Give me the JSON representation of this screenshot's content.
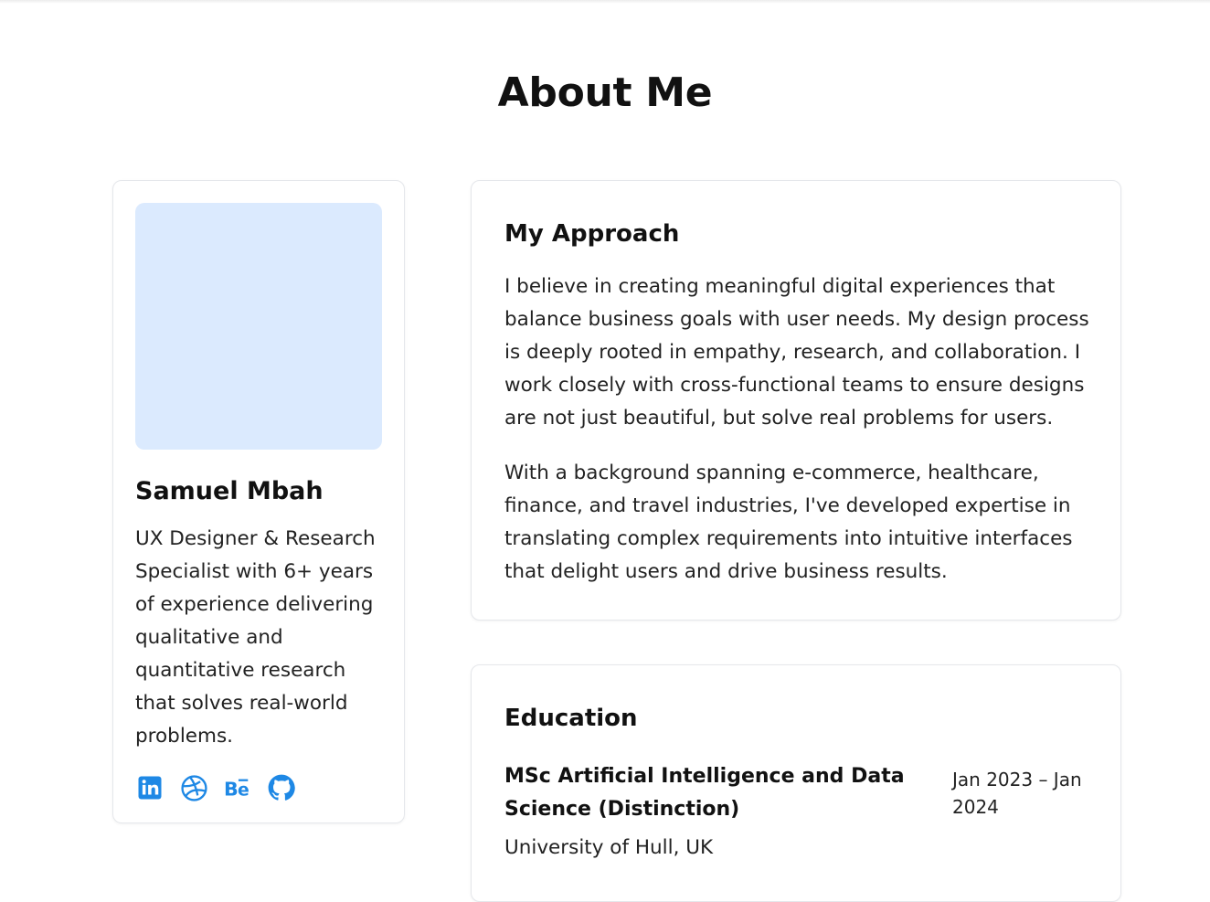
{
  "page": {
    "title": "About Me"
  },
  "profile": {
    "name": "Samuel Mbah",
    "bio": "UX Designer & Research Specialist with 6+ years of experience delivering qualitative and quantitative research that solves real-world problems.",
    "social_icons": [
      "linkedin-icon",
      "dribbble-icon",
      "behance-icon",
      "github-icon"
    ],
    "avatar_color": "#dbeafe",
    "accent_color": "#1e88e5"
  },
  "approach": {
    "title": "My Approach",
    "paragraphs": [
      "I believe in creating meaningful digital experiences that balance business goals with user needs. My design process is deeply rooted in empathy, research, and collaboration. I work closely with cross-functional teams to ensure designs are not just beautiful, but solve real problems for users.",
      "With a background spanning e-commerce, healthcare, finance, and travel industries, I've developed expertise in translating complex requirements into intuitive interfaces that delight users and drive business results."
    ]
  },
  "education": {
    "title": "Education",
    "items": [
      {
        "degree": "MSc Artificial Intelligence and Data Science (Distinction)",
        "dates": "Jan 2023 – Jan 2024",
        "school": "University of Hull, UK"
      }
    ]
  }
}
